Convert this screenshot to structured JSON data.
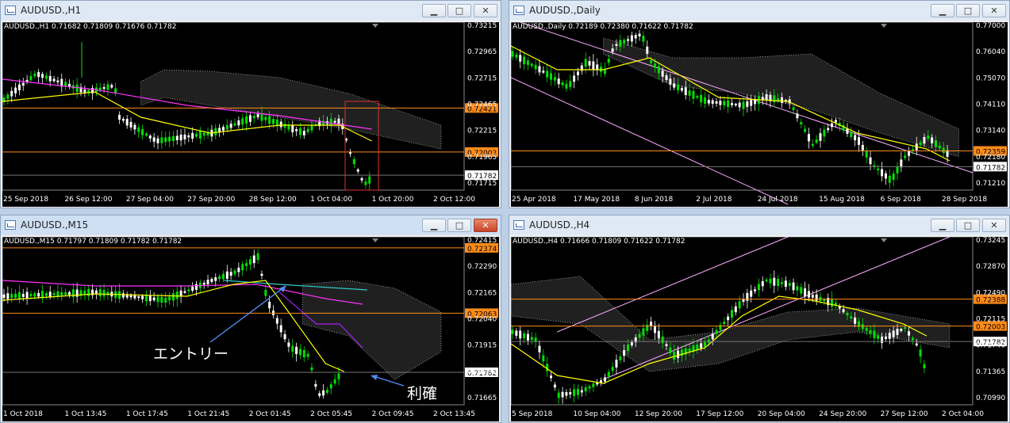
{
  "windows": [
    {
      "id": "w1",
      "title": "AUDUSD.,H1",
      "header": "AUDUSD.,H1  0.71682 0.71809 0.71676 0.71782",
      "prices": [
        "0.73215",
        "0.72965",
        "0.72715",
        "0.72465",
        "0.72215",
        "0.71965",
        "0.71715"
      ],
      "xlabels": [
        "25 Sep 2018",
        "26 Sep 12:00",
        "27 Sep 04:00",
        "27 Sep 20:00",
        "28 Sep 12:00",
        "1 Oct 04:00",
        "1 Oct 20:00",
        "2 Oct 12:00"
      ],
      "levels": [
        {
          "label": "0.72421",
          "color": "#ff8c1a",
          "value": 0.72421
        },
        {
          "label": "0.72002",
          "color": "#ff8c1a",
          "value": 0.72002
        },
        {
          "label": "0.71782",
          "color": "#ffffff",
          "value": 0.71782
        }
      ]
    },
    {
      "id": "w2",
      "title": "AUDUSD.,Daily",
      "header": "AUDUSD.,Daily  0.72189 0.72380 0.71622 0.71782",
      "prices": [
        "0.77000",
        "0.76040",
        "0.75070",
        "0.74110",
        "0.73140",
        "0.72180",
        "0.71210"
      ],
      "xlabels": [
        "25 Apr 2018",
        "17 May 2018",
        "8 Jun 2018",
        "2 Jul 2018",
        "24 Jul 2018",
        "15 Aug 2018",
        "6 Sep 2018",
        "28 Sep 2018"
      ],
      "levels": [
        {
          "label": "0.72359",
          "color": "#ff8c1a",
          "value": 0.72359
        },
        {
          "label": "0.71782",
          "color": "#ffffff",
          "value": 0.71782
        }
      ]
    },
    {
      "id": "w3",
      "title": "AUDUSD.,M15",
      "header": "AUDUSD.,M15  0.71797 0.71809 0.71782 0.71782",
      "prices": [
        "0.72415",
        "0.72290",
        "0.72165",
        "0.72040",
        "0.71915",
        "0.71790",
        "0.71665"
      ],
      "xlabels": [
        "1 Oct 2018",
        "1 Oct 13:45",
        "1 Oct 17:45",
        "1 Oct 21:45",
        "2 Oct 01:45",
        "2 Oct 05:45",
        "2 Oct 09:45",
        "2 Oct 13:45"
      ],
      "levels": [
        {
          "label": "0.72374",
          "color": "#ff8c1a",
          "value": 0.72374
        },
        {
          "label": "0.72063",
          "color": "#ff8c1a",
          "value": 0.72063
        },
        {
          "label": "0.71782",
          "color": "#ffffff",
          "value": 0.71782
        }
      ],
      "annotations": {
        "entry": "エントリー",
        "profit": "利確"
      }
    },
    {
      "id": "w4",
      "title": "AUDUSD.,H4",
      "header": "AUDUSD.,H4  0.71666 0.71809 0.71622 0.71782",
      "prices": [
        "0.73245",
        "0.72870",
        "0.72490",
        "0.72115",
        "0.71740",
        "0.71365",
        "0.70990"
      ],
      "xlabels": [
        "5 Sep 2018",
        "10 Sep 04:00",
        "12 Sep 20:00",
        "17 Sep 12:00",
        "20 Sep 04:00",
        "24 Sep 20:00",
        "27 Sep 12:00",
        "2 Oct 04:00"
      ],
      "levels": [
        {
          "label": "0.72388",
          "color": "#ff8c1a",
          "value": 0.72388
        },
        {
          "label": "0.72003",
          "color": "#ff8c1a",
          "value": 0.72003
        },
        {
          "label": "0.71782",
          "color": "#ffffff",
          "value": 0.71782
        }
      ]
    }
  ],
  "buttons": {
    "min": "▁",
    "max": "□",
    "close": "✕"
  },
  "colors": {
    "bull": "#00e000",
    "bear": "#ffffff",
    "ma_fast": "#ffff00",
    "ma_slow": "#ff33ff",
    "ichimoku": "#b0b0b0",
    "channel": "#ffaaff",
    "level": "#ff8c1a",
    "callout_arrow": "#4c8ff0"
  }
}
